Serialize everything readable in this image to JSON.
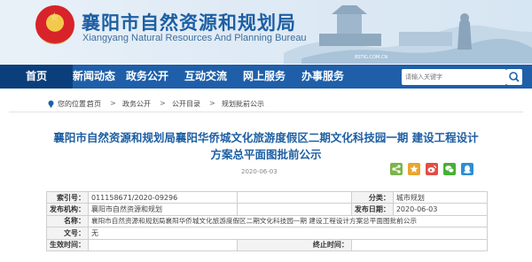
{
  "header": {
    "title": "襄阳市自然资源和规划局",
    "subtitle": "Xiangyang Natural Resources And Planning Bureau",
    "watermark": "BSTIG.COM.CN"
  },
  "nav": {
    "items": [
      {
        "label": "首页",
        "active": true
      },
      {
        "label": "新闻动态",
        "active": false
      },
      {
        "label": "政务公开",
        "active": false
      },
      {
        "label": "互动交流",
        "active": false
      },
      {
        "label": "网上服务",
        "active": false
      },
      {
        "label": "办事服务",
        "active": false
      }
    ],
    "search_placeholder": "请输入关键字"
  },
  "breadcrumb": {
    "prefix": "您的位置：",
    "items": [
      "首页",
      "政务公开",
      "公开目录",
      "规划批前公示"
    ],
    "separator": ">"
  },
  "article": {
    "title_line1": "襄阳市自然资源和规划局襄阳华侨城文化旅游度假区二期文化科技园一期 建设工程设计",
    "title_line2": "方案总平面图批前公示",
    "date": "2020-06-03",
    "share_icons": [
      "share-icon",
      "qzone-icon",
      "weibo-icon",
      "wechat-icon",
      "qq-icon"
    ],
    "share_colors": [
      "#7bb54a",
      "#e8a530",
      "#e24d46",
      "#45b035",
      "#2d8fd5"
    ]
  },
  "meta": {
    "index_label": "索引号：",
    "index_value": "011158671/2020-09296",
    "category_label": "分类：",
    "category_value": "城市规划",
    "issuer_label": "发布机构：",
    "issuer_value": "襄阳市自然资源和规划",
    "date_label": "发布日期：",
    "date_value": "2020-06-03",
    "name_label": "名称：",
    "name_value": "襄阳市自然资源和规划局襄阳华侨城文化旅游度假区二期文化科技园一期 建设工程设计方案总平面图批前公示",
    "docno_label": "文号：",
    "docno_value": "无",
    "effective_label": "生效时间：",
    "effective_value": "",
    "expire_label": "终止时间：",
    "expire_value": ""
  }
}
